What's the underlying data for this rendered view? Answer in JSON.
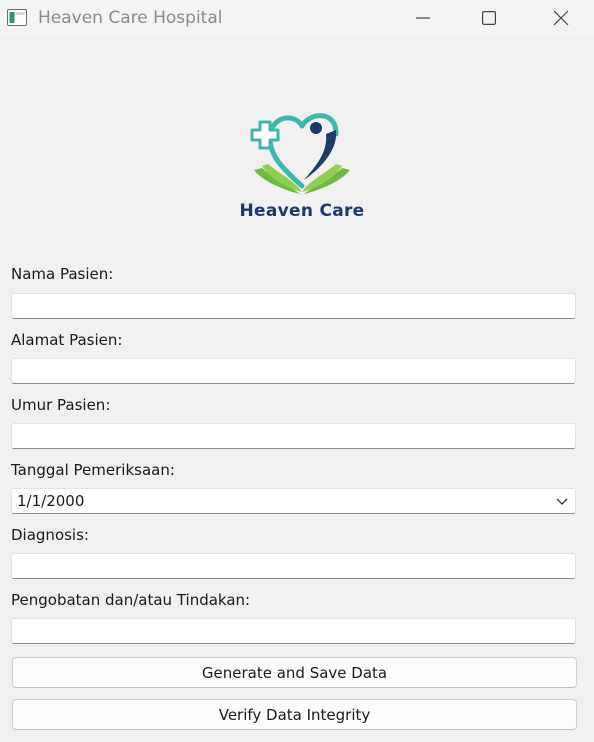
{
  "window": {
    "title": "Heaven Care Hospital",
    "controls": [
      "minimize",
      "maximize",
      "close"
    ]
  },
  "logo": {
    "text": "Heaven Care",
    "colors": {
      "teal": "#3bb7ad",
      "navy": "#1e3a6b",
      "green": "#6cbb3c"
    }
  },
  "form": {
    "nama_label": "Nama Pasien:",
    "nama_value": "",
    "alamat_label": "Alamat Pasien:",
    "alamat_value": "",
    "umur_label": "Umur Pasien:",
    "umur_value": "",
    "tanggal_label": "Tanggal Pemeriksaan:",
    "tanggal_value": "1/1/2000",
    "diagnosis_label": "Diagnosis:",
    "diagnosis_value": "",
    "pengobatan_label": "Pengobatan dan/atau Tindakan:",
    "pengobatan_value": ""
  },
  "buttons": {
    "generate": "Generate and Save Data",
    "verify": "Verify Data Integrity"
  }
}
